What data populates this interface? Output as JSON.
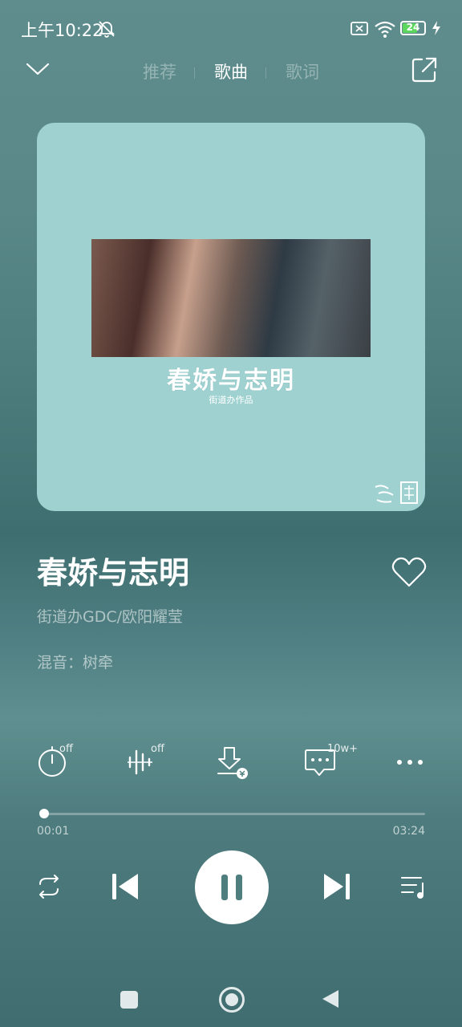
{
  "status": {
    "time": "上午10:22",
    "battery": "24"
  },
  "nav": {
    "tabs": [
      {
        "label": "推荐",
        "active": false
      },
      {
        "label": "歌曲",
        "active": true
      },
      {
        "label": "歌词",
        "active": false
      }
    ]
  },
  "album": {
    "cover_title": "春娇与志明",
    "cover_subtitle": "街道办作品",
    "colors": {
      "cover_bg": "#9fd1d1"
    }
  },
  "song": {
    "title": "春娇与志明",
    "artists": "街道办GDC/欧阳耀莹",
    "mix": "混音：树牵",
    "liked": false
  },
  "actions": {
    "sleep_timer_badge": "off",
    "sound_effect_badge": "off",
    "comments_badge": "10w+"
  },
  "progress": {
    "current": "00:01",
    "total": "03:24",
    "fraction": 0.005
  },
  "player": {
    "state": "playing"
  },
  "icons": [
    "collapse-chevron-icon",
    "share-icon",
    "heart-icon",
    "sleep-timer-icon",
    "sound-effect-icon",
    "download-icon",
    "comment-icon",
    "more-icon",
    "repeat-icon",
    "previous-icon",
    "pause-icon",
    "next-icon",
    "playlist-icon",
    "nav-recents-icon",
    "nav-home-icon",
    "nav-back-icon"
  ]
}
